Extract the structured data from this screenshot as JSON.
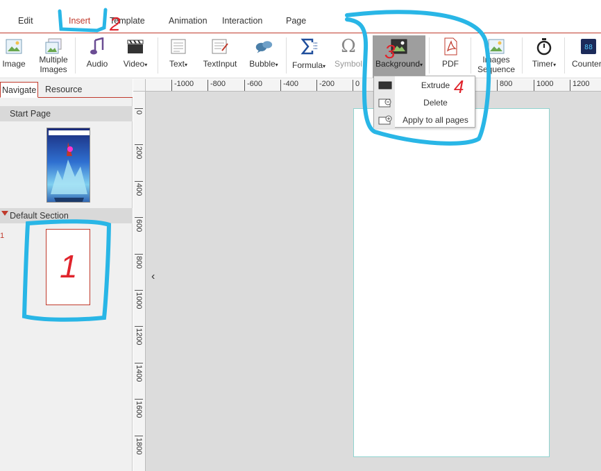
{
  "menu": {
    "items": [
      {
        "label": "Edit"
      },
      {
        "label": "Insert"
      },
      {
        "label": "Template"
      },
      {
        "label": "Animation"
      },
      {
        "label": "Interaction"
      },
      {
        "label": "Page"
      }
    ]
  },
  "ribbon": {
    "image": "Image",
    "multiple_images_1": "Multiple",
    "multiple_images_2": "Images",
    "audio": "Audio",
    "video": "Video",
    "text": "Text",
    "textinput": "TextInput",
    "bubble": "Bubble",
    "formula": "Formula",
    "symbol": "Symbol",
    "background": "Background",
    "pdf": "PDF",
    "images_sequence_1": "Images",
    "images_sequence_2": "Sequence",
    "timer": "Timer",
    "counter": "Counter",
    "caret": "▾"
  },
  "dropdown": {
    "items": [
      {
        "label": "Extrude"
      },
      {
        "label": "Delete"
      },
      {
        "label": "Apply to all pages"
      }
    ]
  },
  "left_panel": {
    "tabs": [
      {
        "label": "Navigate"
      },
      {
        "label": "Resource"
      }
    ],
    "start_page": "Start Page",
    "section": "Default Section",
    "page_number": "1",
    "page_thumb_label": "1"
  },
  "rulers": {
    "horizontal": [
      "-1000",
      "-800",
      "-600",
      "-400",
      "-200",
      "0",
      "800",
      "1000",
      "1200"
    ],
    "vertical": [
      "0",
      "200",
      "400",
      "600",
      "800",
      "1000",
      "1200",
      "1400",
      "1600",
      "1800"
    ]
  },
  "annotations": {
    "marks": [
      "1",
      "2",
      "3",
      "4"
    ],
    "colors": {
      "red": "#e0242c",
      "blue": "#29b6e6"
    }
  },
  "colors": {
    "accent": "#c0392b",
    "page_border": "#8fd3cf",
    "workspace": "#dcdcdc"
  }
}
